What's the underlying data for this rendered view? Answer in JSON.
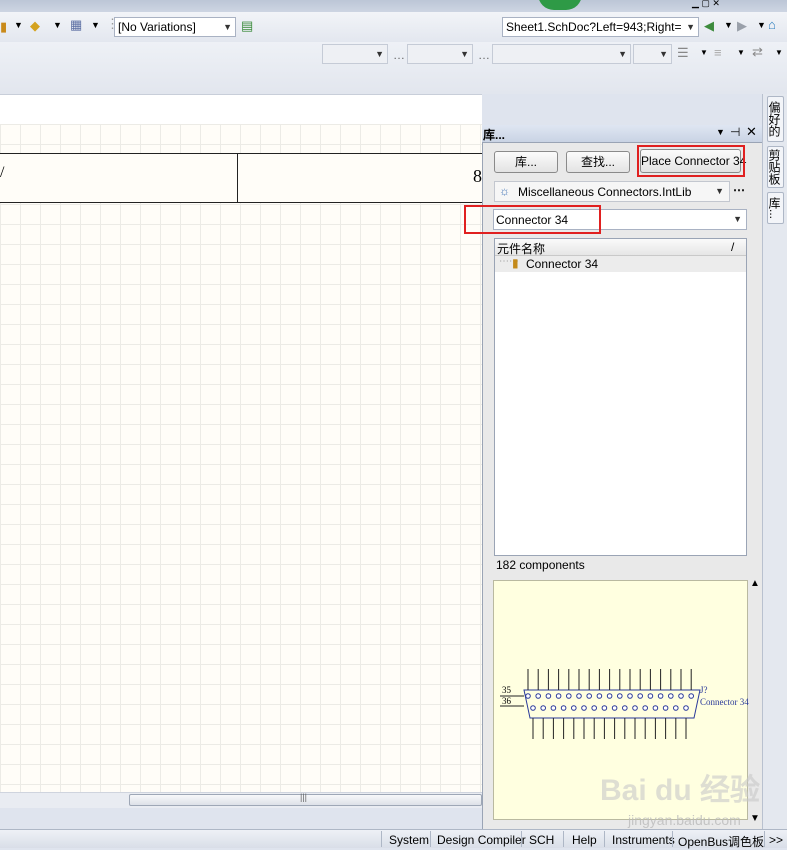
{
  "toolbar": {
    "variations_value": "[No Variations]",
    "sheet_address": "Sheet1.SchDoc?Left=943;Right="
  },
  "document": {
    "title_block_right": "8",
    "title_block_left": "/"
  },
  "panel": {
    "title": "库...",
    "libraries_button": "库...",
    "search_button": "查找...",
    "place_button": "Place Connector 34",
    "library_name": "Miscellaneous Connectors.IntLib",
    "filter_value": "Connector 34",
    "column_header": "元件名称",
    "column_sort": "/",
    "components": [
      "Connector 34"
    ],
    "count": "182 components",
    "preview": {
      "designator": "J?",
      "comment": "Connector 34",
      "left_pin_top": "35",
      "left_pin_bottom": "36"
    }
  },
  "side_tabs": [
    "偏好的",
    "剪贴板",
    "库..."
  ],
  "status_bar": [
    "System",
    "Design Compiler",
    "SCH",
    "Help",
    "Instruments",
    "OpenBus调色板",
    ">>"
  ],
  "watermark": {
    "brand": "Bai du 经验",
    "url": "jingyan.baidu.com"
  },
  "colors": {
    "highlight": "#e02020",
    "panel_header": "#c9d3e4",
    "preview_bg": "#ffffe0"
  }
}
